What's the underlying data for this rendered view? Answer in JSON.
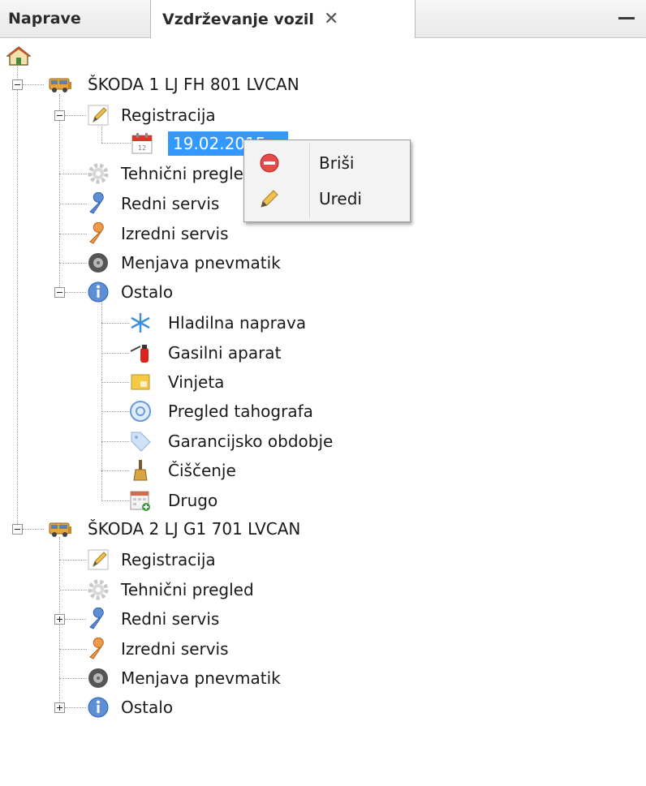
{
  "tabs": {
    "devices": "Naprave",
    "maintenance": "Vzdrževanje vozil",
    "close_glyph": "✕"
  },
  "tree": {
    "vehicles": [
      {
        "name": "ŠKODA 1 LJ FH 801 LVCAN",
        "expanded": true,
        "items": [
          {
            "label": "Registracija",
            "icon": "pencil-icon",
            "expanded": true,
            "children": [
              {
                "label": "19.02.2015",
                "icon": "calendar-icon",
                "selected": true
              }
            ]
          },
          {
            "label": "Tehnični pregled",
            "icon": "gear-icon"
          },
          {
            "label": "Redni servis",
            "icon": "blue-wrench-icon"
          },
          {
            "label": "Izredni servis",
            "icon": "orange-wrench-icon"
          },
          {
            "label": "Menjava pnevmatik",
            "icon": "tire-icon"
          },
          {
            "label": "Ostalo",
            "icon": "info-icon",
            "expanded": true,
            "children": [
              {
                "label": "Hladilna naprava",
                "icon": "snowflake-icon"
              },
              {
                "label": "Gasilni aparat",
                "icon": "fire-extinguisher-icon"
              },
              {
                "label": "Vinjeta",
                "icon": "vignette-icon"
              },
              {
                "label": "Pregled tahografa",
                "icon": "tachograph-icon"
              },
              {
                "label": "Garancijsko obdobje",
                "icon": "tag-icon"
              },
              {
                "label": "Čiščenje",
                "icon": "broom-icon"
              },
              {
                "label": "Drugo",
                "icon": "other-calendar-icon"
              }
            ]
          }
        ]
      },
      {
        "name": "ŠKODA 2 LJ G1 701 LVCAN",
        "expanded": true,
        "items": [
          {
            "label": "Registracija",
            "icon": "pencil-icon"
          },
          {
            "label": "Tehnični pregled",
            "icon": "gear-icon"
          },
          {
            "label": "Redni servis",
            "icon": "blue-wrench-icon",
            "collapsed": true
          },
          {
            "label": "Izredni servis",
            "icon": "orange-wrench-icon"
          },
          {
            "label": "Menjava pnevmatik",
            "icon": "tire-icon"
          },
          {
            "label": "Ostalo",
            "icon": "info-icon",
            "collapsed": true
          }
        ]
      }
    ]
  },
  "context_menu": {
    "delete": "Briši",
    "edit": "Uredi"
  },
  "colors": {
    "selection": "#3399ff",
    "menu_bg": "#f3f3f3",
    "truck_body": "#e8a33c"
  }
}
